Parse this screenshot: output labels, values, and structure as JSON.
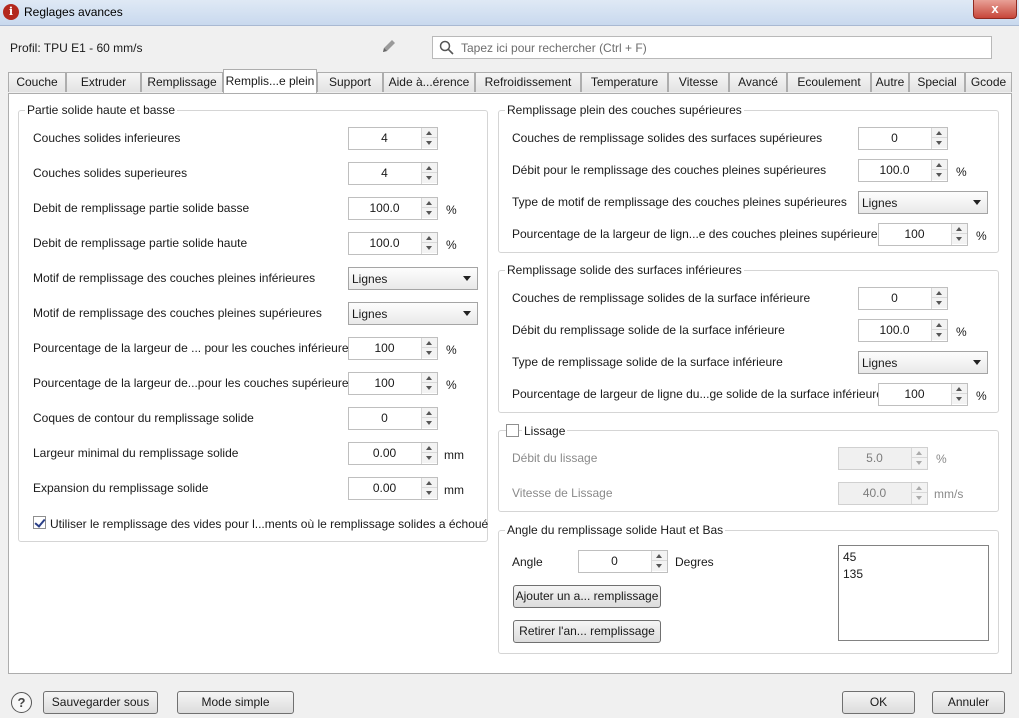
{
  "window": {
    "title": "Reglages avances",
    "close": "x"
  },
  "profile": {
    "label": "Profil: TPU E1 - 60 mm/s"
  },
  "search": {
    "placeholder": "Tapez ici pour rechercher (Ctrl + F)"
  },
  "tabs": [
    "Couche",
    "Extruder",
    "Remplissage",
    "Remplis...e plein",
    "Support",
    "Aide à...érence",
    "Refroidissement",
    "Temperature",
    "Vitesse",
    "Avancé",
    "Ecoulement",
    "Autre",
    "Special",
    "Gcode"
  ],
  "active_tab": 3,
  "left_group": {
    "title": "Partie solide haute et basse",
    "rows": [
      {
        "label": "Couches solides inferieures",
        "value": "4",
        "unit": ""
      },
      {
        "label": "Couches solides superieures",
        "value": "4",
        "unit": ""
      },
      {
        "label": "Debit de remplissage partie solide basse",
        "value": "100.0",
        "unit": "%"
      },
      {
        "label": "Debit de remplissage partie solide haute",
        "value": "100.0",
        "unit": "%"
      },
      {
        "label": "Motif de remplissage des couches pleines inférieures",
        "value": "Lignes",
        "unit": ""
      },
      {
        "label": "Motif de remplissage des couches pleines supérieures",
        "value": "Lignes",
        "unit": ""
      },
      {
        "label": "Pourcentage de la largeur de ... pour les couches inférieures",
        "value": "100",
        "unit": "%"
      },
      {
        "label": "Pourcentage de la largeur de...pour les couches supérieures",
        "value": "100",
        "unit": "%"
      },
      {
        "label": "Coques de contour du remplissage solide",
        "value": "0",
        "unit": ""
      },
      {
        "label": "Largeur minimal du remplissage solide",
        "value": "0.00",
        "unit": "mm"
      },
      {
        "label": "Expansion du remplissage solide",
        "value": "0.00",
        "unit": "mm"
      }
    ],
    "checkbox_label": "Utiliser le remplissage des vides pour l...ments où le remplissage solides a échoué"
  },
  "top_group": {
    "title": "Remplissage plein des couches supérieures",
    "rows": [
      {
        "label": "Couches de remplissage solides des surfaces supérieures",
        "value": "0",
        "unit": ""
      },
      {
        "label": "Débit pour le remplissage des couches pleines supérieures",
        "value": "100.0",
        "unit": "%"
      },
      {
        "label": "Type de motif de remplissage des couches pleines supérieures",
        "value": "Lignes",
        "unit": ""
      },
      {
        "label": "Pourcentage de la largeur de lign...e des couches pleines supérieures",
        "value": "100",
        "unit": "%"
      }
    ]
  },
  "bottom_group": {
    "title": "Remplissage solide des surfaces inférieures",
    "rows": [
      {
        "label": "Couches de remplissage solides de la surface inférieure",
        "value": "0",
        "unit": ""
      },
      {
        "label": "Débit du remplissage solide de la surface inférieure",
        "value": "100.0",
        "unit": "%"
      },
      {
        "label": "Type de remplissage solide de la surface inférieure",
        "value": "Lignes",
        "unit": ""
      },
      {
        "label": "Pourcentage de largeur de ligne du...ge solide de la surface inférieure",
        "value": "100",
        "unit": "%"
      }
    ]
  },
  "ironing_group": {
    "title": "Lissage",
    "rows": [
      {
        "label": "Débit du lissage",
        "value": "5.0",
        "unit": "%"
      },
      {
        "label": "Vitesse de Lissage",
        "value": "40.0",
        "unit": "mm/s"
      }
    ]
  },
  "angle_group": {
    "title": "Angle du remplissage solide Haut et Bas",
    "angle_label": "Angle",
    "angle_value": "0",
    "angle_unit": "Degres",
    "add_button": "Ajouter un a... remplissage",
    "remove_button": "Retirer l'an... remplissage",
    "list": [
      "45",
      "135"
    ]
  },
  "footer": {
    "help": "?",
    "save_as": "Sauvegarder sous",
    "simple_mode": "Mode simple",
    "ok": "OK",
    "cancel": "Annuler"
  }
}
